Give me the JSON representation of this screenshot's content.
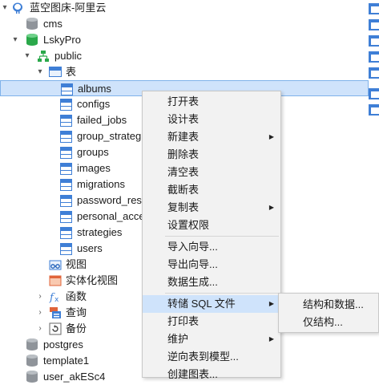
{
  "tree": {
    "connection": "蓝空图床-阿里云",
    "databases": [
      {
        "name": "cms"
      },
      {
        "name": "LskyPro"
      }
    ],
    "schema": "public",
    "tables_group": "表",
    "tables": [
      "albums",
      "configs",
      "failed_jobs",
      "group_strateg",
      "groups",
      "images",
      "migrations",
      "password_rese",
      "personal_acce",
      "strategies",
      "users"
    ],
    "selected_table": "albums",
    "views": "视图",
    "materialized_views": "实体化视图",
    "functions": "函数",
    "queries": "查询",
    "backups": "备份",
    "other_databases": [
      "postgres",
      "template1",
      "user_akESc4"
    ]
  },
  "context_menu": {
    "items": [
      {
        "label": "打开表",
        "submenu": false
      },
      {
        "label": "设计表",
        "submenu": false
      },
      {
        "label": "新建表",
        "submenu": true
      },
      {
        "label": "删除表",
        "submenu": false
      },
      {
        "label": "清空表",
        "submenu": false
      },
      {
        "label": "截断表",
        "submenu": false
      },
      {
        "label": "复制表",
        "submenu": true
      },
      {
        "label": "设置权限",
        "submenu": false
      },
      {
        "label": "导入向导...",
        "submenu": false
      },
      {
        "label": "导出向导...",
        "submenu": false
      },
      {
        "label": "数据生成...",
        "submenu": false
      },
      {
        "label": "转储 SQL 文件",
        "submenu": true,
        "highlighted": true
      },
      {
        "label": "打印表",
        "submenu": false
      },
      {
        "label": "维护",
        "submenu": true
      },
      {
        "label": "逆向表到模型...",
        "submenu": false
      },
      {
        "label": "创建图表...",
        "submenu": false
      }
    ],
    "arrow_glyph": "▶"
  },
  "submenu": {
    "items": [
      "结构和数据...",
      "仅结构..."
    ]
  },
  "colors": {
    "selection": "#cfe3fb",
    "accent_blue": "#3f7fd6",
    "db_green": "#2aa84a",
    "db_gray": "#8f949a"
  }
}
